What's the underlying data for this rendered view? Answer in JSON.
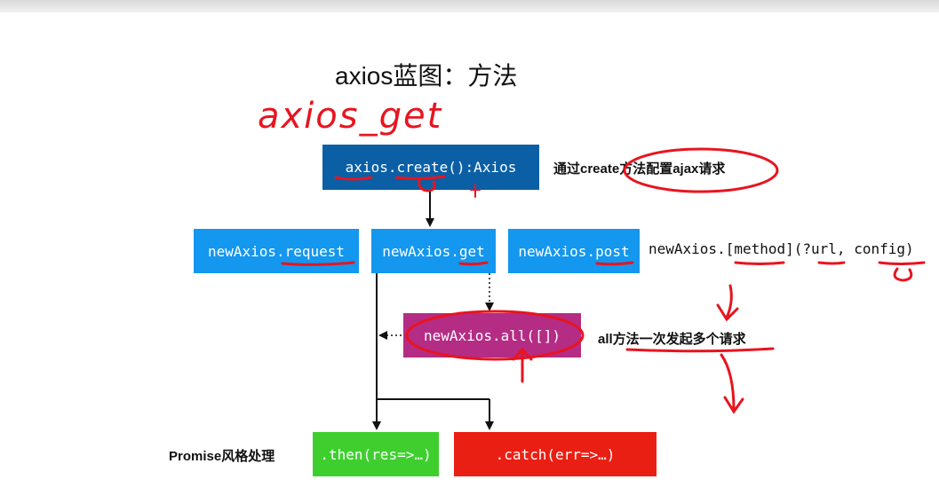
{
  "title": "axios蓝图：方法",
  "annotation": "axios_get",
  "boxes": {
    "create": "axios.create():Axios",
    "request": "newAxios.request",
    "get": "newAxios.get",
    "post": "newAxios.post",
    "all": "newAxios.all([])",
    "then": ".then(res=>…)",
    "catch": ".catch(err=>…)"
  },
  "labels": {
    "create_desc": "通过create方法配置ajax请求",
    "all_desc": "all方法一次发起多个请求",
    "promise_style": "Promise风格处理",
    "method_signature": "newAxios.[method](?url, config)"
  },
  "colors": {
    "create_box": "#0b5fa5",
    "method_box": "#1497ee",
    "all_box": "#b52c84",
    "then_box": "#3ecf2f",
    "catch_box": "#ea1f14",
    "ink": "#e8141f"
  }
}
